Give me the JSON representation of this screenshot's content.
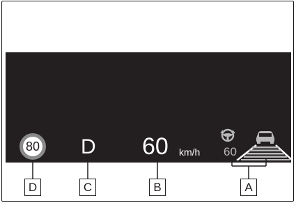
{
  "display": {
    "speed_limit": "80",
    "gear": "D",
    "speed": "60",
    "speed_unit": "km/h",
    "set_speed": "60"
  },
  "labels": {
    "a": "A",
    "b": "B",
    "c": "C",
    "d": "D"
  },
  "colors": {
    "display_background": "#231f20",
    "speed_limit_ring": "#8a8a8a",
    "set_speed": "#b8b8b8",
    "lane_stripes": "#b8b8b8"
  },
  "icons": [
    "steering-wheel-icon",
    "vehicle-ahead-icon",
    "lane-distance-icon"
  ]
}
